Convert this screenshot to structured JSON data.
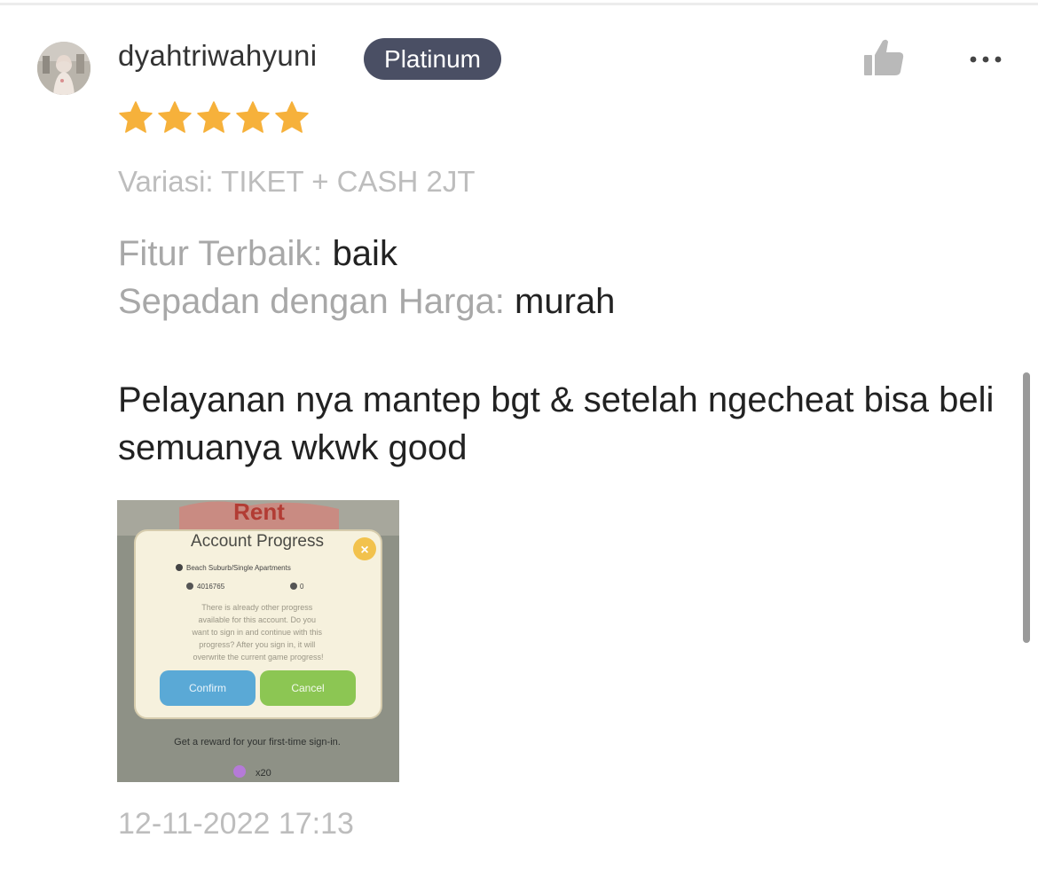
{
  "review": {
    "username": "dyahtriwahyuni",
    "badge": "Platinum",
    "rating": 5,
    "variation": "Variasi: TIKET + CASH 2JT",
    "features": [
      {
        "label": "Fitur Terbaik: ",
        "value": "baik"
      },
      {
        "label": "Sepadan dengan Harga: ",
        "value": "murah"
      }
    ],
    "comment": "Pelayanan nya mantep bgt & setelah ngecheat bisa beli semuanya wkwk good",
    "timestamp": "12-11-2022 17:13"
  },
  "photo": {
    "title": "Account Progress",
    "location": "Beach Suburb/Single Apartments",
    "coins": "4016765",
    "gems": "0",
    "message": "There is already other progress available for this account. Do you want to sign in and continue with this progress? After you sign in, it will overwrite the current game progress!",
    "confirm_label": "Confirm",
    "cancel_label": "Cancel",
    "reward_text": "Get a reward for your first-time sign-in.",
    "reward_count": "x20"
  },
  "icons": {
    "like": "thumbs-up-icon",
    "more": "more-icon",
    "star": "star-icon"
  },
  "colors": {
    "badge_bg": "#4a4f64",
    "star": "#f6b13b",
    "icon_gray": "#b9b9b9"
  }
}
